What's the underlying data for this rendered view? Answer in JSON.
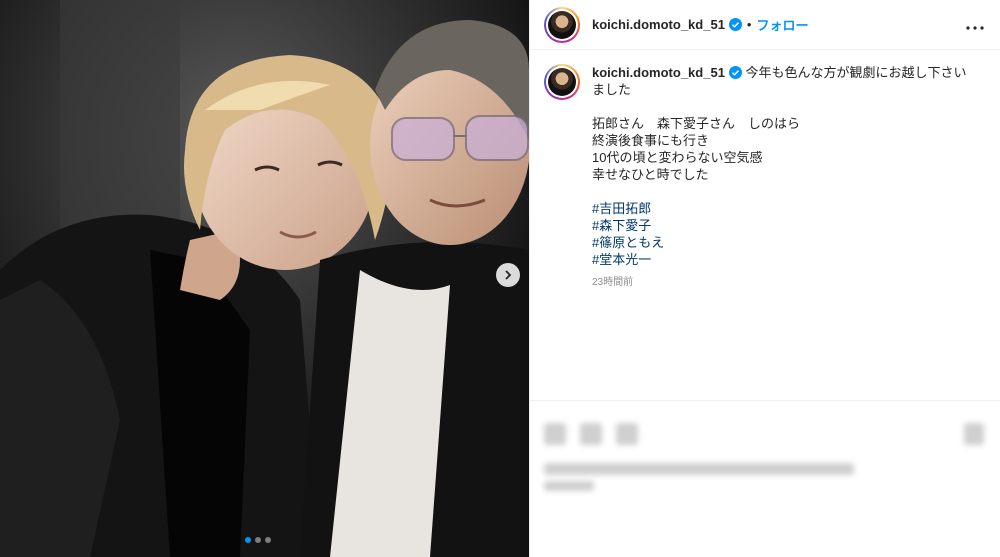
{
  "post": {
    "username": "koichi.domoto_kd_51",
    "follow_label": "フォロー",
    "separator": "•",
    "caption_intro": "今年も色んな方が観劇にお越し下さいました",
    "caption_lines": [
      "拓郎さん　森下愛子さん　しのはら",
      "終演後食事にも行き",
      "10代の頃と変わらない空気感",
      "幸せなひと時でした"
    ],
    "hashtags": [
      "#吉田拓郎",
      "#森下愛子",
      "#篠原ともえ",
      "#堂本光一"
    ],
    "timestamp": "23時間前",
    "carousel": {
      "count": 3,
      "active_index": 0
    }
  },
  "colors": {
    "accent": "#0095f6",
    "hashtag": "#00376b",
    "muted": "#8e8e8e"
  },
  "icons": {
    "verified": "verified-badge-icon",
    "more": "more-options-icon",
    "next": "chevron-right-icon"
  }
}
